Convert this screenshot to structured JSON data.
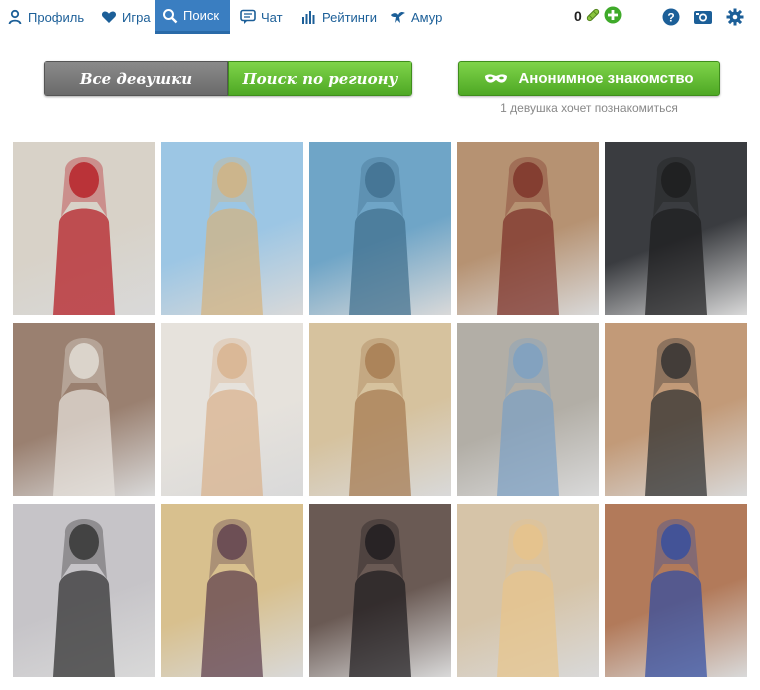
{
  "nav": {
    "items": [
      {
        "label": "Профиль",
        "icon": "profile-icon"
      },
      {
        "label": "Игра",
        "icon": "heart-icon"
      },
      {
        "label": "Поиск",
        "icon": "search-icon",
        "active": true
      },
      {
        "label": "Чат",
        "icon": "chat-icon"
      },
      {
        "label": "Рейтинги",
        "icon": "ratings-icon"
      },
      {
        "label": "Амур",
        "icon": "cupid-icon"
      }
    ],
    "coins": "0",
    "right_icons": [
      "help-icon",
      "camera-icon",
      "settings-icon"
    ]
  },
  "toggle": {
    "all_label": "Все девушки",
    "region_label": "Поиск по региону",
    "selected": "region"
  },
  "anon": {
    "label": "Анонимное знакомство",
    "subtitle": "1 девушка хочет познакомиться"
  },
  "colors": {
    "nav_text": "#1c5f98",
    "nav_active_bg": "#3a7ec1",
    "green": "#5cb82e",
    "gray": "#7a7a7a"
  },
  "photos": [
    {
      "name": "photo-1",
      "bg": "#d8d2c8",
      "fg": "#b4141c"
    },
    {
      "name": "photo-2",
      "bg": "#9cc6e4",
      "fg": "#d6b27c"
    },
    {
      "name": "photo-3",
      "bg": "#6fa5c7",
      "fg": "#3e6e8c"
    },
    {
      "name": "photo-4",
      "bg": "#b69272",
      "fg": "#7a2e26"
    },
    {
      "name": "photo-5",
      "bg": "#3a3c40",
      "fg": "#1c1c1e"
    },
    {
      "name": "photo-6",
      "bg": "#9a8070",
      "fg": "#e8e4de"
    },
    {
      "name": "photo-7",
      "bg": "#e6e2dc",
      "fg": "#d8b08a"
    },
    {
      "name": "photo-8",
      "bg": "#d6c29e",
      "fg": "#a4774e"
    },
    {
      "name": "photo-9",
      "bg": "#b2aea6",
      "fg": "#7aa0c4"
    },
    {
      "name": "photo-10",
      "bg": "#c29a78",
      "fg": "#2a2c2e"
    },
    {
      "name": "photo-11",
      "bg": "#c6c4c8",
      "fg": "#2a2a2a"
    },
    {
      "name": "photo-12",
      "bg": "#d8c08e",
      "fg": "#5a3a4a"
    },
    {
      "name": "photo-13",
      "bg": "#6a5a54",
      "fg": "#1c1a1c"
    },
    {
      "name": "photo-14",
      "bg": "#d6c4a8",
      "fg": "#e8c48a"
    },
    {
      "name": "photo-15",
      "bg": "#b27a5a",
      "fg": "#2e4ca4"
    }
  ]
}
